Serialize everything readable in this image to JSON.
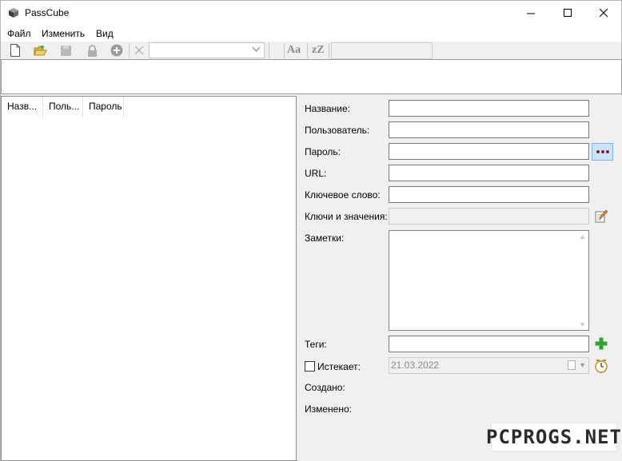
{
  "window": {
    "title": "PassCube",
    "controls": {
      "minimize": "minimize-icon",
      "maximize": "maximize-icon",
      "close": "close-icon"
    }
  },
  "menu": {
    "items": [
      "Файл",
      "Изменить",
      "Вид"
    ]
  },
  "toolbar": {
    "buttons": [
      "new-file-icon",
      "open-file-icon",
      "save-icon",
      "lock-icon",
      "add-circle-icon",
      "delete-x-icon"
    ],
    "search": {
      "value": ""
    },
    "case_sensitive_label": "Aa",
    "sort_label": "zZ",
    "filter": {
      "value": ""
    }
  },
  "list": {
    "columns": [
      "Назв...",
      "Поль...",
      "Пароль"
    ]
  },
  "details": {
    "name_label": "Название:",
    "user_label": "Пользователь:",
    "password_label": "Пароль:",
    "url_label": "URL:",
    "keyword_label": "Ключевое слово:",
    "kv_label": "Ключи и значения:",
    "notes_label": "Заметки:",
    "tags_label": "Теги:",
    "expires_label": "Истекает:",
    "expires_date": "21.03.2022",
    "created_label": "Создано:",
    "modified_label": "Изменено:"
  },
  "watermark": "PCPROGS.NET",
  "colors": {
    "accent_button": "#cce4f7",
    "dots": "#8b1a3a",
    "add_icon": "#2ea82e"
  }
}
